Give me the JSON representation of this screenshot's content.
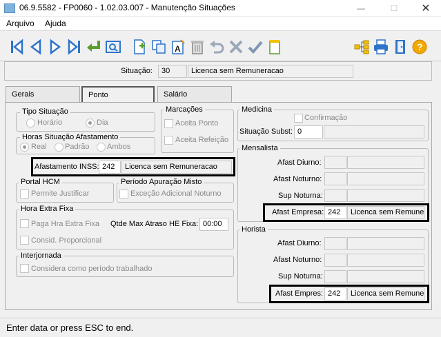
{
  "window": {
    "title": "06.9.5582 - FP0060 - 1.02.03.007 - Manutenção Situações",
    "minimize": "—",
    "maximize": "☐",
    "close": "✕"
  },
  "menu": {
    "arquivo": "Arquivo",
    "ajuda": "Ajuda"
  },
  "toolbar": {
    "icons": [
      "first-record-icon",
      "previous-record-icon",
      "next-record-icon",
      "last-record-icon",
      "select-icon",
      "search-icon",
      "new-record-icon",
      "copy-icon",
      "edit-icon",
      "delete-icon",
      "undo-icon",
      "cancel-icon",
      "confirm-icon",
      "notes-icon",
      "hierarchy-icon",
      "print-icon",
      "exit-icon",
      "help-icon"
    ],
    "accent": "#2e74c8"
  },
  "header": {
    "situacao_label": "Situação:",
    "situacao_code": "30",
    "situacao_desc": "Licenca sem Remuneracao"
  },
  "tabs": [
    "Gerais",
    "Ponto",
    "Salário"
  ],
  "ponto": {
    "tipo_situacao": {
      "title": "Tipo Situação",
      "options": [
        "Horário",
        "Dia"
      ],
      "selected": "Dia"
    },
    "horas_afastamento": {
      "title": "Horas Situação Afastamento",
      "options": [
        "Real",
        "Padrão",
        "Ambos"
      ],
      "selected": "Real"
    },
    "marcacoes": {
      "title": "Marcações",
      "aceita_ponto": "Aceita Ponto",
      "aceita_refeicao": "Aceita Refeição"
    },
    "afastamento_inss": {
      "label": "Afastamento INSS:",
      "code": "242",
      "desc": "Licenca sem Remuneracao"
    },
    "portal_hcm": {
      "title": "Portal HCM",
      "permite_justificar": "Permite Justificar"
    },
    "periodo_apuracao": {
      "title": "Período Apuração Misto",
      "excecao": "Exceção Adicional Noturno"
    },
    "hora_extra": {
      "title": "Hora Extra Fixa",
      "paga": "Paga Hra Extra Fixa",
      "consid": "Consid. Proporcional",
      "qtde_label": "Qtde Max Atraso HE Fixa:",
      "qtde_value": "00:00"
    },
    "interjornada": {
      "title": "Interjornada",
      "considera": "Considera como período trabalhado"
    },
    "medicina": {
      "title": "Medicina",
      "confirmacao": "Confirmação",
      "situacao_subst_label": "Situação Subst:",
      "situacao_subst_value": "0"
    },
    "mensalista": {
      "title": "Mensalista",
      "afast_diurno": "Afast Diurno:",
      "afast_noturno": "Afast Noturno:",
      "sup_noturna": "Sup Noturna:",
      "afast_empresa_label": "Afast Empresa:",
      "afast_empresa_code": "242",
      "afast_empresa_desc": "Licenca sem Remunera"
    },
    "horista": {
      "title": "Horista",
      "afast_diurno": "Afast Diurno:",
      "afast_noturno": "Afast Noturno:",
      "sup_noturna": "Sup Noturna:",
      "afast_empres_label": "Afast Empres:",
      "afast_empres_code": "242",
      "afast_empres_desc": "Licenca sem Remunera"
    }
  },
  "status": {
    "text": "Enter data or press ESC to end."
  }
}
